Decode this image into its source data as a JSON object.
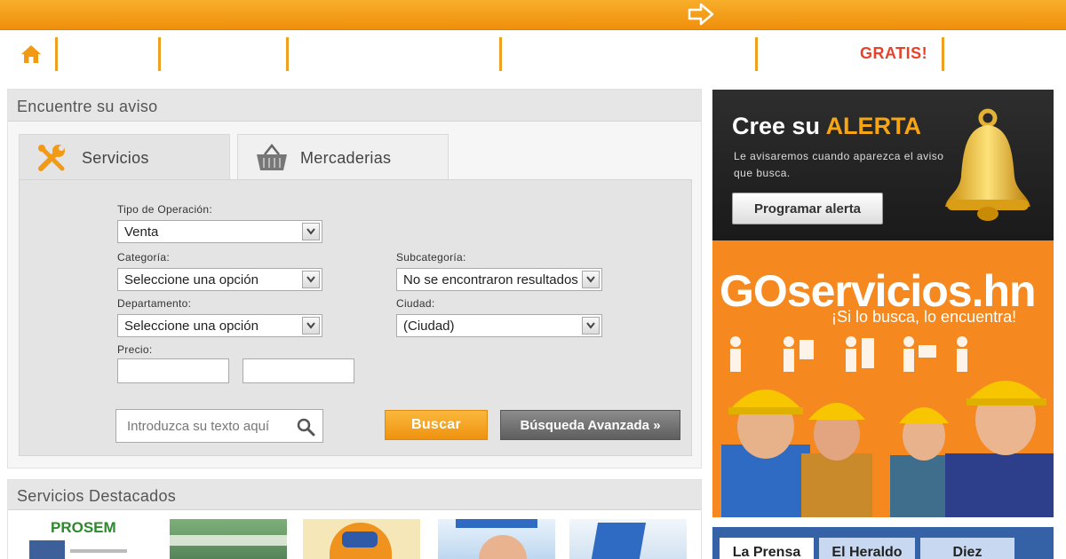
{
  "topbar": {
    "color": "#f29a14",
    "icons": [
      "arrow-right-icon"
    ]
  },
  "nav": {
    "icons": [
      "home-icon"
    ],
    "gratis_label": "GRATIS!",
    "separator_color": "#f0a020"
  },
  "search": {
    "title": "Encuentre su aviso",
    "tabs": [
      {
        "label": "Servicios",
        "icon": "wrench-icon",
        "active": true
      },
      {
        "label": "Mercaderias",
        "icon": "basket-icon",
        "active": false
      }
    ],
    "tipo_label": "Tipo de Operación:",
    "tipo_value": "Venta",
    "categoria_label": "Categoría:",
    "categoria_value": "Seleccione una opción",
    "subcategoria_label": "Subcategoría:",
    "subcategoria_value": "No se encontraron resultados",
    "departamento_label": "Departamento:",
    "departamento_value": "Seleccione una opción",
    "ciudad_label": "Ciudad:",
    "ciudad_value": "(Ciudad)",
    "precio_label": "Precio:",
    "text_placeholder": "Introduzca su texto aquí",
    "buscar_label": "Buscar",
    "avanzada_label": "Búsqueda Avanzada »"
  },
  "featured": {
    "title": "Servicios Destacados",
    "thumb_text": "PROSEM"
  },
  "alert": {
    "title_prefix": "Cree su",
    "title_accent": "ALERTA",
    "description": "Le avisaremos cuando aparezca el aviso que busca.",
    "button_label": "Programar alerta",
    "accent_color": "#f6a514"
  },
  "goservicios": {
    "brand_go": "GO",
    "brand_rest": "servicios.hn",
    "tagline": "¡Si lo busca, lo encuentra!",
    "background": "#f5891f"
  },
  "newspapers": {
    "tabs": [
      "La Prensa",
      "El Heraldo",
      "Diez"
    ]
  }
}
